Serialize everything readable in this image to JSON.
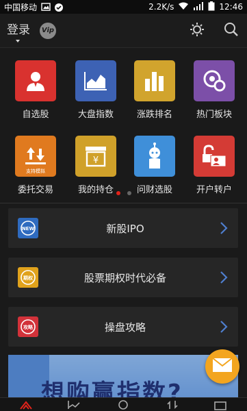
{
  "status_bar": {
    "carrier": "中国移动",
    "speed": "2.2K/s",
    "time": "12:46",
    "icons": [
      "image-icon",
      "check-circle-icon",
      "wifi-icon",
      "signal-icon",
      "battery-icon"
    ]
  },
  "header": {
    "login_label": "登录",
    "vip_label": "Vip",
    "icons": [
      "settings-sun-icon",
      "search-icon"
    ]
  },
  "grid": {
    "items": [
      {
        "label": "自选股",
        "icon": "person-icon",
        "color": "#d9322f"
      },
      {
        "label": "大盘指数",
        "icon": "area-chart-icon",
        "color": "#3d62b4"
      },
      {
        "label": "涨跌排名",
        "icon": "bar-chart-icon",
        "color": "#d1a42d"
      },
      {
        "label": "热门板块",
        "icon": "circles-icon",
        "color": "#7c4fa8"
      },
      {
        "label": "委托交易",
        "icon": "up-down-arrows-icon",
        "color": "#e07a1f",
        "badge": "支持模拟"
      },
      {
        "label": "我的持仓",
        "icon": "yen-box-icon",
        "color": "#d0a12a"
      },
      {
        "label": "问财选股",
        "icon": "robot-icon",
        "color": "#3f8fd9"
      },
      {
        "label": "开户转户",
        "icon": "id-card-lock-icon",
        "color": "#d43b35"
      }
    ],
    "page_count": 2,
    "active_page": 0
  },
  "list": {
    "items": [
      {
        "label": "新股IPO",
        "icon": "new-badge-icon",
        "icon_text": "NEW",
        "color": "#2f6bbf"
      },
      {
        "label": "股票期权时代必备",
        "icon": "option-badge-icon",
        "icon_text": "期权",
        "color": "#e0a21c"
      },
      {
        "label": "操盘攻略",
        "icon": "strategy-badge-icon",
        "icon_text": "攻略",
        "color": "#d2323a"
      }
    ]
  },
  "banner": {
    "text": "想购赢指数?"
  },
  "colors": {
    "background": "#1a1a1a",
    "row_bg": "#262626",
    "accent_red": "#e2231a",
    "chevron": "#4f7fcf",
    "mail": "#f3a51f"
  }
}
